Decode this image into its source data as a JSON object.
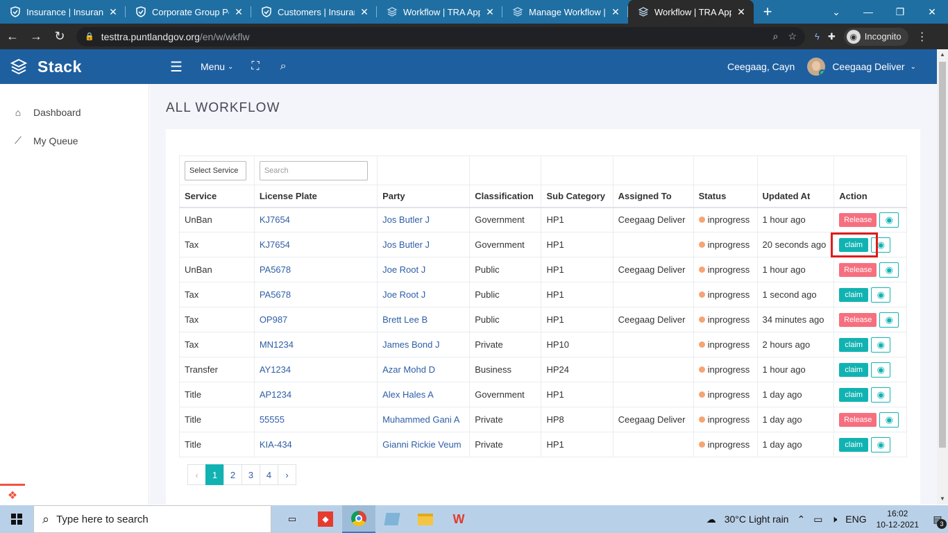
{
  "browser": {
    "tabs": [
      {
        "label": "Insurance | Insurance",
        "icon": "shield-icon",
        "active": false
      },
      {
        "label": "Corporate Group Polic",
        "icon": "shield-icon",
        "active": false
      },
      {
        "label": "Customers | Insurance",
        "icon": "shield-icon",
        "active": false
      },
      {
        "label": "Workflow | TRA App",
        "icon": "stack-icon",
        "active": false
      },
      {
        "label": "Manage Workflow | TF",
        "icon": "stack-icon",
        "active": false
      },
      {
        "label": "Workflow | TRA App",
        "icon": "stack-icon",
        "active": true
      }
    ],
    "new_tab": "+",
    "url_host": "testtra.puntlandgov.org",
    "url_path": "/en/w/wkflw",
    "incognito_label": "Incognito"
  },
  "header": {
    "brand": "Stack",
    "menu_label": "Menu",
    "user_name": "Ceegaag, Cayn",
    "user_role": "Ceegaag Deliver"
  },
  "sidebar": {
    "items": [
      {
        "label": "Dashboard",
        "icon": "home-icon"
      },
      {
        "label": "My Queue",
        "icon": "trend-line-icon"
      }
    ]
  },
  "page": {
    "title": "ALL WORKFLOW",
    "filters": {
      "service_select": "Select Service",
      "search_placeholder": "Search"
    },
    "table": {
      "columns": [
        "Service",
        "License Plate",
        "Party",
        "Classification",
        "Sub Category",
        "Assigned To",
        "Status",
        "Updated At",
        "Action"
      ],
      "rows": [
        {
          "service": "UnBan",
          "plate": "KJ7654",
          "party": "Jos Butler J",
          "classification": "Government",
          "subcat": "HP1",
          "assigned": "Ceegaag Deliver",
          "status": "inprogress",
          "updated": "1 hour ago",
          "action": "Release"
        },
        {
          "service": "Tax",
          "plate": "KJ7654",
          "party": "Jos Butler J",
          "classification": "Government",
          "subcat": "HP1",
          "assigned": "",
          "status": "inprogress",
          "updated": "20 seconds ago",
          "action": "claim"
        },
        {
          "service": "UnBan",
          "plate": "PA5678",
          "party": "Joe Root J",
          "classification": "Public",
          "subcat": "HP1",
          "assigned": "Ceegaag Deliver",
          "status": "inprogress",
          "updated": "1 hour ago",
          "action": "Release"
        },
        {
          "service": "Tax",
          "plate": "PA5678",
          "party": "Joe Root J",
          "classification": "Public",
          "subcat": "HP1",
          "assigned": "",
          "status": "inprogress",
          "updated": "1 second ago",
          "action": "claim"
        },
        {
          "service": "Tax",
          "plate": "OP987",
          "party": "Brett Lee B",
          "classification": "Public",
          "subcat": "HP1",
          "assigned": "Ceegaag Deliver",
          "status": "inprogress",
          "updated": "34 minutes ago",
          "action": "Release"
        },
        {
          "service": "Tax",
          "plate": "MN1234",
          "party": "James Bond J",
          "classification": "Private",
          "subcat": "HP10",
          "assigned": "",
          "status": "inprogress",
          "updated": "2 hours ago",
          "action": "claim"
        },
        {
          "service": "Transfer",
          "plate": "AY1234",
          "party": "Azar Mohd D",
          "classification": "Business",
          "subcat": "HP24",
          "assigned": "",
          "status": "inprogress",
          "updated": "1 hour ago",
          "action": "claim"
        },
        {
          "service": "Title",
          "plate": "AP1234",
          "party": "Alex Hales A",
          "classification": "Government",
          "subcat": "HP1",
          "assigned": "",
          "status": "inprogress",
          "updated": "1 day ago",
          "action": "claim"
        },
        {
          "service": "Title",
          "plate": "55555",
          "party": "Muhammed Gani A",
          "classification": "Private",
          "subcat": "HP8",
          "assigned": "Ceegaag Deliver",
          "status": "inprogress",
          "updated": "1 day ago",
          "action": "Release"
        },
        {
          "service": "Title",
          "plate": "KIA-434",
          "party": "Gianni Rickie Veum",
          "classification": "Private",
          "subcat": "HP1",
          "assigned": "",
          "status": "inprogress",
          "updated": "1 day ago",
          "action": "claim"
        }
      ]
    },
    "pagination": {
      "prev": "‹",
      "pages": [
        "1",
        "2",
        "3",
        "4"
      ],
      "current": "1",
      "next": "›"
    }
  },
  "taskbar": {
    "search_placeholder": "Type here to search",
    "weather": "30°C  Light rain",
    "language": "ENG",
    "time": "16:02",
    "date": "10-12-2021",
    "notifications": "3"
  },
  "colors": {
    "header_bg": "#1e5fa0",
    "claim": "#11b3b2",
    "release": "#f66f7f",
    "status_dot": "#f7a374",
    "link": "#2e5ea6"
  }
}
